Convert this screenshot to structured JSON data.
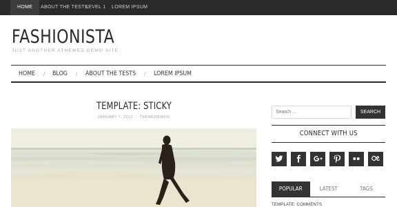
{
  "topbar": {
    "items": [
      "HOME",
      "ABOUT THE TESTS",
      "LEVEL 1",
      "LOREM IPSUM"
    ]
  },
  "site": {
    "title": "FASHIONISTA",
    "description": "JUST ANOTHER ATHEMES DEMO SITE"
  },
  "mainnav": {
    "items": [
      "HOME",
      "BLOG",
      "ABOUT THE TESTS",
      "LOREM IPSUM"
    ],
    "separator": "/"
  },
  "post": {
    "title": "TEMPLATE: STICKY",
    "date": "JANUARY 7, 2012",
    "author": "THEMEDEMOS"
  },
  "sidebar": {
    "search": {
      "placeholder": "Search ...",
      "button": "SEARCH"
    },
    "connect_title": "CONNECT WITH US",
    "social": [
      "twitter-icon",
      "facebook-icon",
      "google-plus-icon",
      "pinterest-icon",
      "flickr-icon",
      "lastfm-icon"
    ],
    "tabs": [
      "POPULAR",
      "LATEST",
      "TAGS"
    ],
    "first_item": "TEMPLATE: COMMENTS"
  },
  "colors": {
    "dark": "#2a2a2a",
    "button": "#333333",
    "muted": "#a8a8a8"
  }
}
